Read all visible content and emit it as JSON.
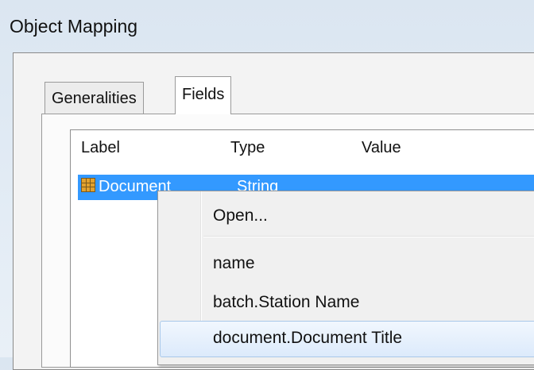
{
  "window": {
    "title": "Object Mapping"
  },
  "tabs": [
    {
      "label": "Generalities",
      "active": false
    },
    {
      "label": "Fields",
      "active": true
    }
  ],
  "list": {
    "columns": [
      "Label",
      "Type",
      "Value"
    ],
    "rows": [
      {
        "label": "Document",
        "type": "String",
        "value": "",
        "selected": true,
        "icon": "table-icon"
      }
    ]
  },
  "context_menu": {
    "items": [
      {
        "label": "Open..."
      },
      {
        "separator": true
      },
      {
        "label": "name"
      },
      {
        "label": "batch.Station Name"
      },
      {
        "label": "document.Document Title",
        "highlighted": true
      }
    ]
  },
  "colors": {
    "selection": "#3399ff",
    "menu_background": "#f0f0f0",
    "menu_highlight": "#dceafb"
  }
}
